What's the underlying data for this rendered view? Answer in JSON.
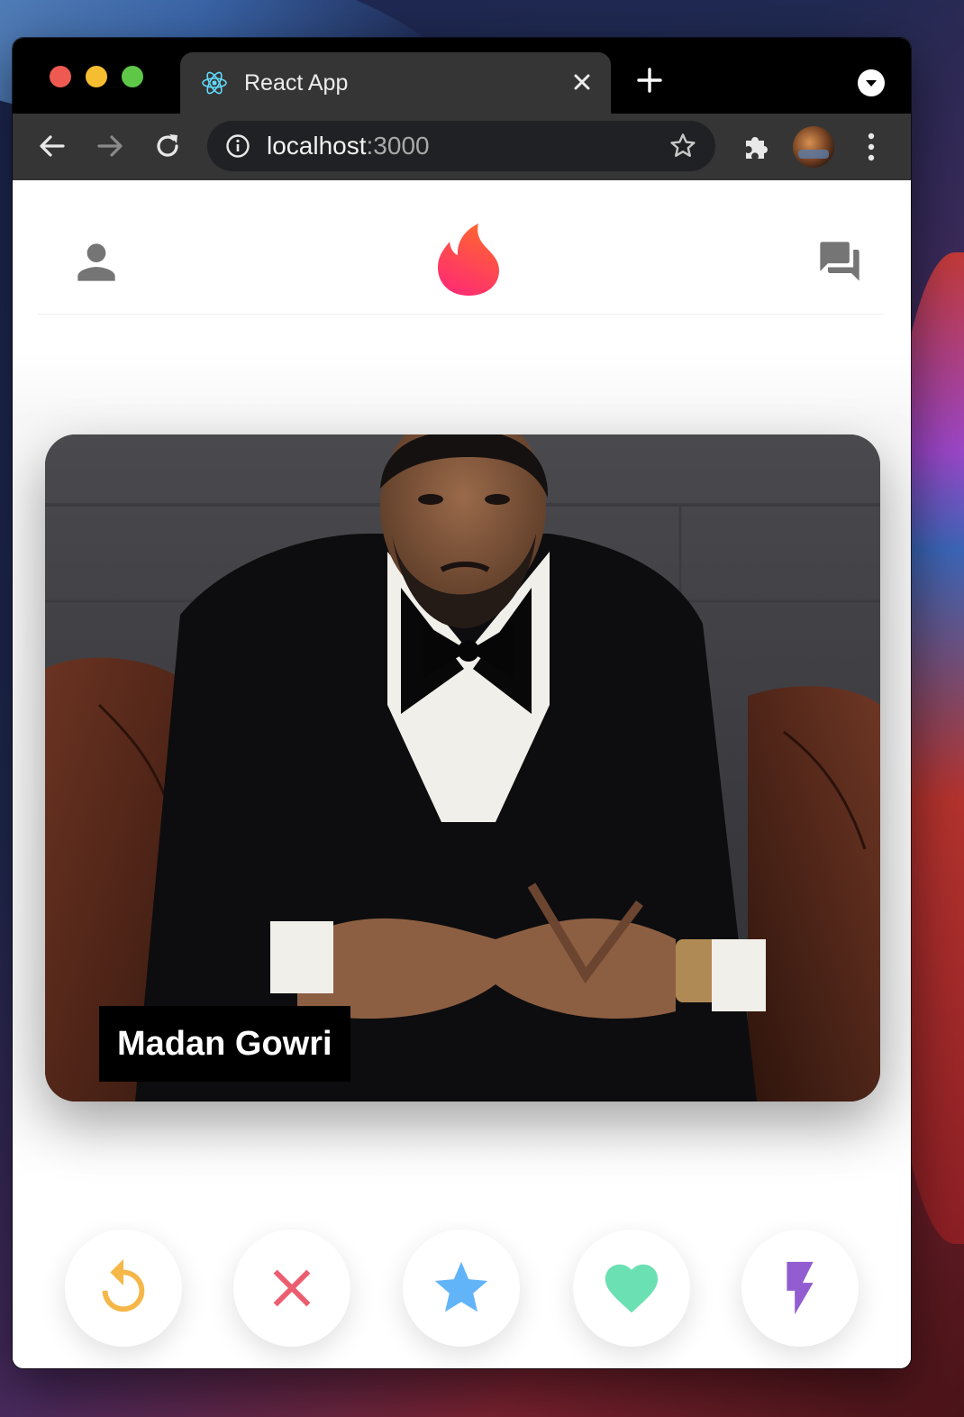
{
  "browser": {
    "tab_title": "React App",
    "tab_close_icon": "close-icon",
    "new_tab_glyph": "+",
    "url_host": "localhost",
    "url_port": ":3000",
    "icons": [
      "back-arrow-icon",
      "forward-arrow-icon",
      "reload-icon",
      "info-icon",
      "bookmark-star-icon",
      "extensions-puzzle-icon",
      "profile-avatar",
      "more-vert-icon",
      "tab-search-icon"
    ]
  },
  "app": {
    "header": {
      "left_icon": "person-icon",
      "center_icon": "tinder-flame-logo",
      "right_icon": "forum-icon",
      "logo_gradient": [
        "#fd267a",
        "#ff6036"
      ]
    },
    "card": {
      "name": "Madan Gowri"
    },
    "actions": [
      {
        "name": "rewind",
        "icon": "replay-icon",
        "color": "#f5b748"
      },
      {
        "name": "nope",
        "icon": "close-icon",
        "color": "#ec5e6f"
      },
      {
        "name": "super-like",
        "icon": "star-icon",
        "color": "#62b4f9"
      },
      {
        "name": "like",
        "icon": "heart-icon",
        "color": "#6be0b2"
      },
      {
        "name": "boost",
        "icon": "flash-icon",
        "color": "#915dd1"
      }
    ]
  }
}
